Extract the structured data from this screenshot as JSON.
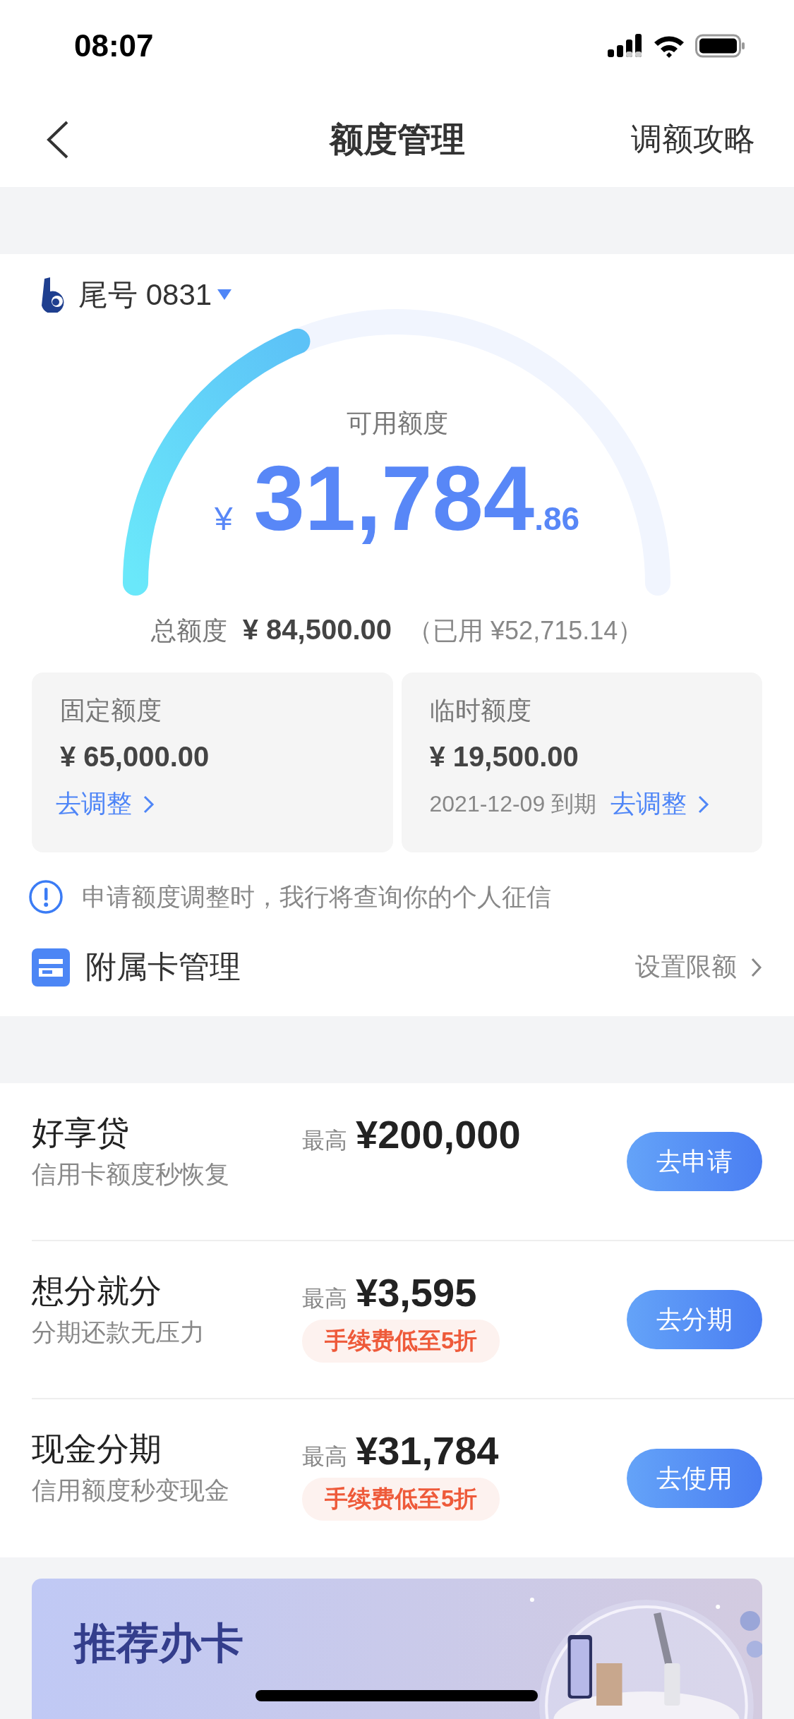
{
  "status_bar": {
    "time": "08:07"
  },
  "nav": {
    "title": "额度管理",
    "action": "调额攻略"
  },
  "account": {
    "label": "尾号 0831"
  },
  "gauge": {
    "label": "可用额度",
    "currency": "¥",
    "integer": "31,784",
    "decimal": ".86"
  },
  "total": {
    "label": "总额度",
    "amount": "¥ 84,500.00",
    "used": "（已用 ¥52,715.14）"
  },
  "limits": [
    {
      "title": "固定额度",
      "amount": "¥ 65,000.00",
      "action": "去调整"
    },
    {
      "title": "临时额度",
      "amount": "¥ 19,500.00",
      "expiry": "2021-12-09 到期",
      "action": "去调整"
    }
  ],
  "notice": "申请额度调整时，我行将查询你的个人征信",
  "supplementary": {
    "title": "附属卡管理",
    "action": "设置限额"
  },
  "products": [
    {
      "name": "好享贷",
      "desc": "信用卡额度秒恢复",
      "prefix": "最高",
      "amount": "¥200,000",
      "button": "去申请"
    },
    {
      "name": "想分就分",
      "desc": "分期还款无压力",
      "prefix": "最高",
      "amount": "¥3,595",
      "tag": "手续费低至5折",
      "button": "去分期"
    },
    {
      "name": "现金分期",
      "desc": "信用额度秒变现金",
      "prefix": "最高",
      "amount": "¥31,784",
      "tag": "手续费低至5折",
      "button": "去使用"
    }
  ],
  "banner": {
    "title": "推荐办卡"
  }
}
